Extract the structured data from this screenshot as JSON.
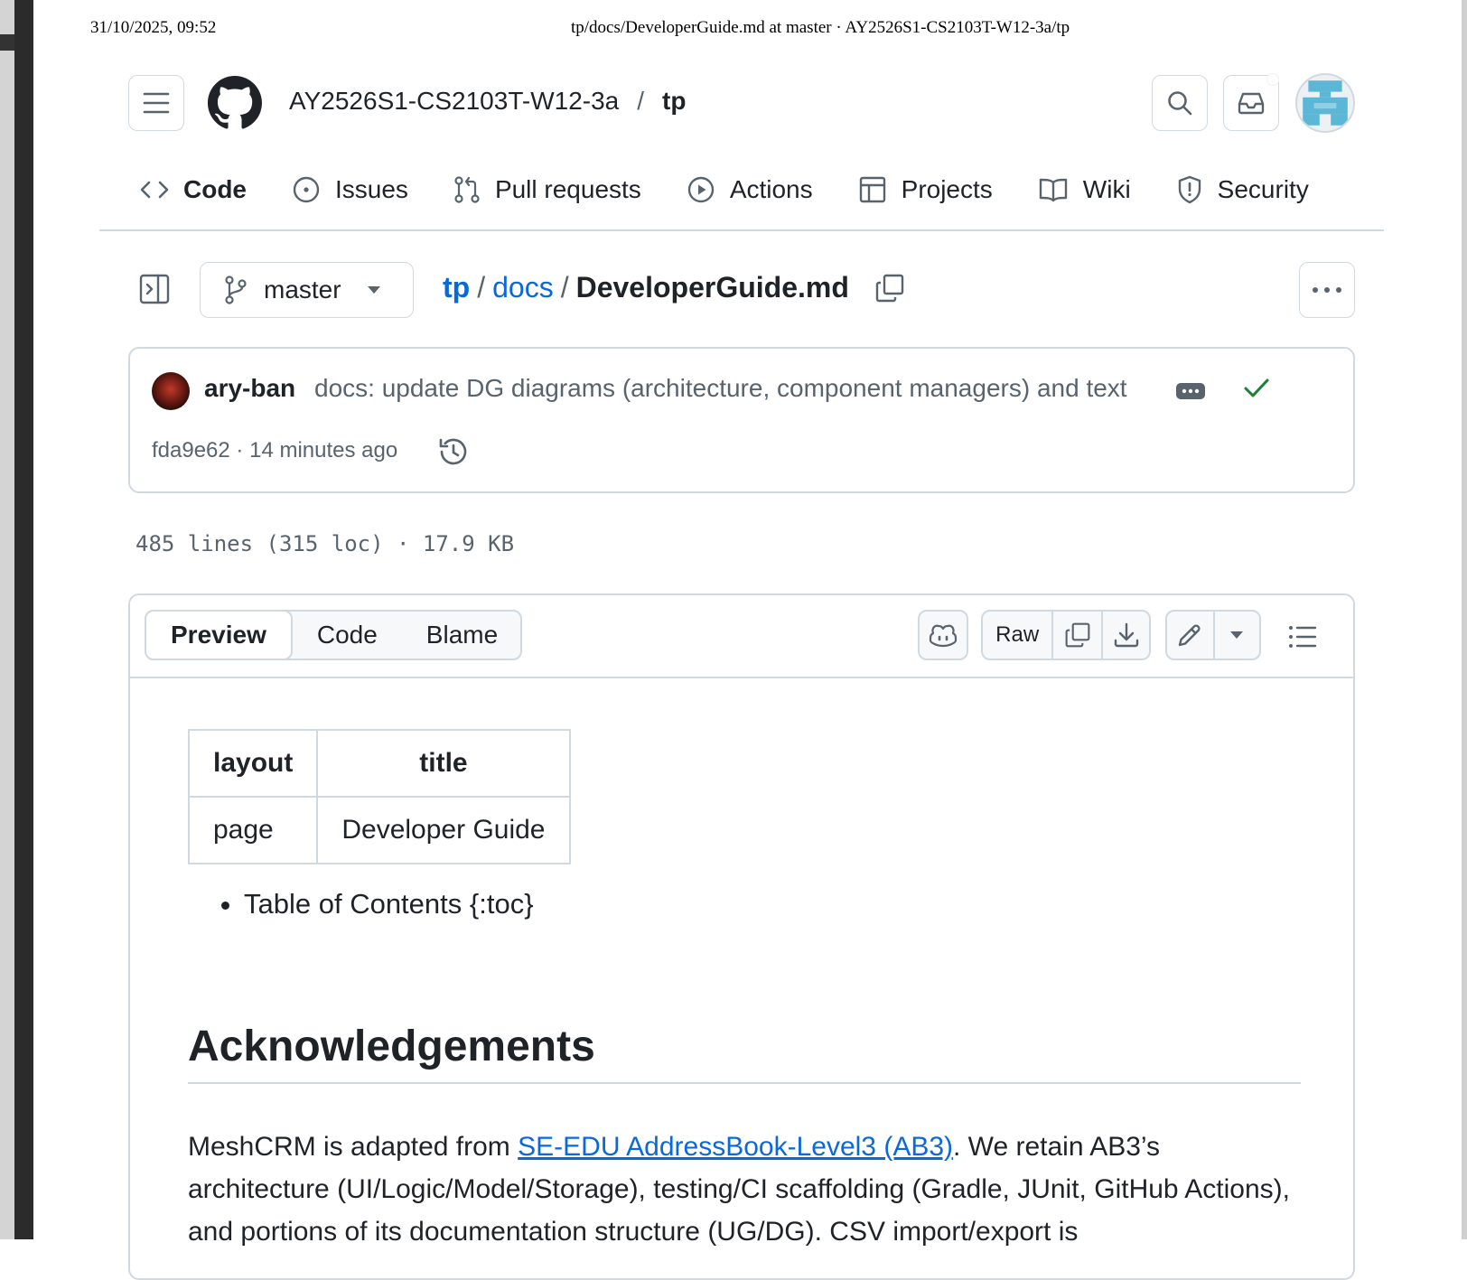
{
  "print_header": {
    "datetime": "31/10/2025, 09:52",
    "title": "tp/docs/DeveloperGuide.md at master · AY2526S1-CS2103T-W12-3a/tp"
  },
  "header": {
    "owner": "AY2526S1-CS2103T-W12-3a",
    "separator": "/",
    "repo": "tp"
  },
  "nav_tabs": [
    {
      "label": "Code",
      "icon": "code-icon",
      "active": true
    },
    {
      "label": "Issues",
      "icon": "issue-icon"
    },
    {
      "label": "Pull requests",
      "icon": "pull-request-icon"
    },
    {
      "label": "Actions",
      "icon": "play-icon"
    },
    {
      "label": "Projects",
      "icon": "table-icon"
    },
    {
      "label": "Wiki",
      "icon": "book-icon"
    },
    {
      "label": "Security",
      "icon": "shield-icon"
    }
  ],
  "file_nav": {
    "branch": "master",
    "breadcrumb": [
      "tp",
      "docs"
    ],
    "separator": "/",
    "filename": "DeveloperGuide.md"
  },
  "commit": {
    "author": "ary-ban",
    "message": "docs: update DG diagrams (architecture, component managers) and text",
    "sha": "fda9e62",
    "time": "14 minutes ago",
    "meta_separator": " · "
  },
  "file_info": "485 lines (315 loc) · 17.9 KB",
  "viewer": {
    "tabs": [
      "Preview",
      "Code",
      "Blame"
    ],
    "active_tab": "Preview",
    "raw_label": "Raw"
  },
  "content": {
    "table": {
      "headers": [
        "layout",
        "title"
      ],
      "rows": [
        [
          "page",
          "Developer Guide"
        ]
      ]
    },
    "bullet": "Table of Contents {:toc}",
    "heading": "Acknowledgements",
    "para_prefix": "MeshCRM is adapted from ",
    "para_link": "SE-EDU AddressBook-Level3 (AB3)",
    "para_suffix": ". We retain AB3’s architecture (UI/Logic/Model/Storage), testing/CI scaffolding (Gradle, JUnit, GitHub Actions), and portions of its documentation structure (UG/DG). CSV import/export is"
  },
  "colors": {
    "link": "#0969da",
    "border": "#d1d9e0",
    "success": "#1a7f37",
    "muted": "#59636e"
  }
}
